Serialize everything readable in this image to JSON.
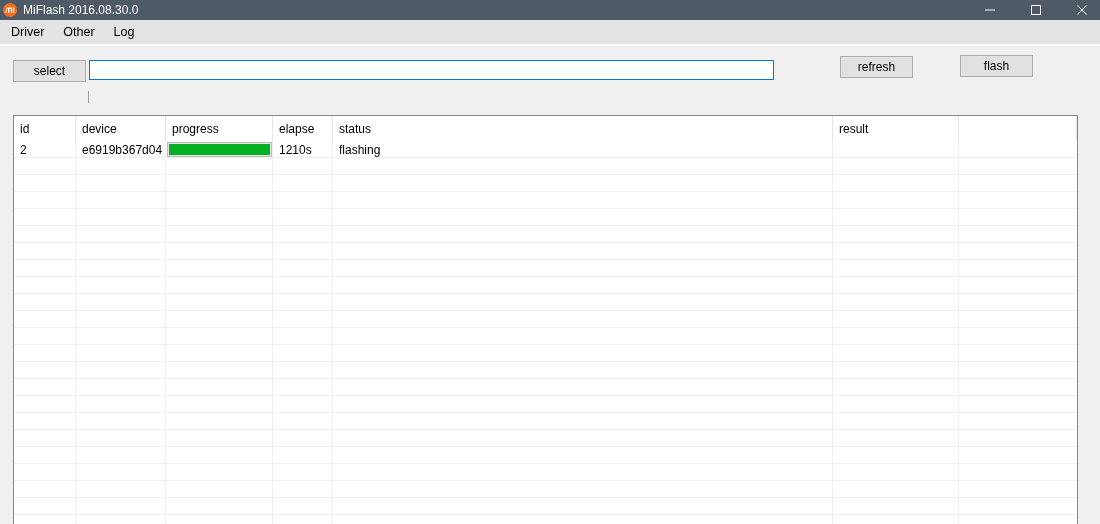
{
  "window": {
    "title": "MiFlash 2016.08.30.0"
  },
  "menu": [
    "Driver",
    "Other",
    "Log"
  ],
  "toolbar": {
    "select_button": "select",
    "refresh_button": "refresh",
    "flash_button": "flash"
  },
  "table": {
    "columns": [
      "id",
      "device",
      "progress",
      "elapse",
      "status",
      "result"
    ],
    "rows": [
      {
        "id": "2",
        "device": "e6919b367d04",
        "progress": {
          "level": 1
        },
        "elapse": "1210s",
        "status": "flashing"
      }
    ]
  }
}
